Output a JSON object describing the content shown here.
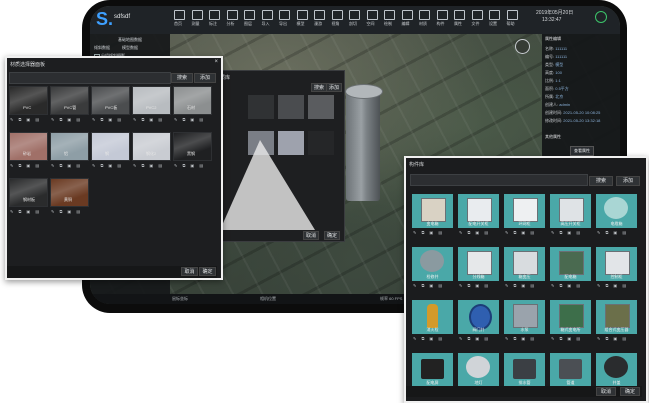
{
  "app": {
    "logo_text": "S.",
    "title": "sdfsdf",
    "datetime_line1": "2019年05月20日",
    "datetime_line2": "13:32:47",
    "toolbar": [
      {
        "label": "首页",
        "icon": "home-icon"
      },
      {
        "label": "测量",
        "icon": "measure-icon"
      },
      {
        "label": "标注",
        "icon": "mark-icon"
      },
      {
        "label": "分析",
        "icon": "analysis-icon"
      },
      {
        "label": "图层",
        "icon": "layer-icon"
      },
      {
        "label": "导入",
        "icon": "import-icon"
      },
      {
        "label": "导出",
        "icon": "export-icon"
      },
      {
        "label": "模型",
        "icon": "model-icon"
      },
      {
        "label": "漫游",
        "icon": "walk-icon"
      },
      {
        "label": "视角",
        "icon": "view-icon"
      },
      {
        "label": "剖切",
        "icon": "section-icon"
      },
      {
        "label": "空间",
        "icon": "space-icon"
      },
      {
        "label": "绘制",
        "icon": "draw-icon"
      },
      {
        "label": "编辑",
        "icon": "edit-icon"
      },
      {
        "label": "材质",
        "icon": "material-icon"
      },
      {
        "label": "构件",
        "icon": "component-icon"
      },
      {
        "label": "属性",
        "icon": "property-icon"
      },
      {
        "label": "文件",
        "icon": "file-icon"
      },
      {
        "label": "设置",
        "icon": "settings-icon"
      },
      {
        "label": "帮助",
        "icon": "help-icon"
      }
    ],
    "left_panel": {
      "tab1": "基础地图数据",
      "tab2": "倾斜数据",
      "tab3": "模型数据",
      "item": "分组倾斜摄影"
    },
    "right_panel": {
      "title": "属性编辑",
      "rows": [
        {
          "label": "名称:",
          "value": "111111"
        },
        {
          "label": "编号:",
          "value": "111111"
        },
        {
          "label": "类型:",
          "value": "模型"
        },
        {
          "label": "高度:",
          "value": "100"
        },
        {
          "label": "比例:",
          "value": "1:1"
        },
        {
          "label": "面积:",
          "value": "0.5平方"
        },
        {
          "label": "所属:",
          "value": "北京"
        },
        {
          "label": "创建人:",
          "value": "admin"
        },
        {
          "label": "创建时间:",
          "value": "2021-05-20 10:08:25"
        },
        {
          "label": "修改时间:",
          "value": "2021-05-20 13:32:18"
        }
      ],
      "section2": "其他属性",
      "button": "查看属性"
    },
    "bottom": {
      "left": "鼠标坐标",
      "mid": "相机位置",
      "right": "帧率 60 FPS"
    }
  },
  "mid_dialog": {
    "title": "材质库",
    "search": "搜索",
    "add": "添加",
    "cancel": "取消",
    "confirm": "确定"
  },
  "material_dialog": {
    "title": "材质选择器面板",
    "search_button": "搜索",
    "add_button": "添加",
    "cancel_button": "取消",
    "confirm_button": "确定",
    "items": [
      {
        "label": "PVC",
        "color": "#2a2a2a"
      },
      {
        "label": "PVC管",
        "color": "#3a3b3c"
      },
      {
        "label": "PVC板",
        "color": "#4b4d4f"
      },
      {
        "label": "PVC2",
        "color": "#b8bcc0"
      },
      {
        "label": "石材",
        "color": "#8c8f90"
      },
      {
        "label": "砂岩",
        "color": "#a07068"
      },
      {
        "label": "铝",
        "color": "#8e9ea6"
      },
      {
        "label": "钢",
        "color": "#c4c9d6"
      },
      {
        "label": "钢化2",
        "color": "#c9ccd2"
      },
      {
        "label": "黑钢",
        "color": "#1f2022"
      },
      {
        "label": "钢材板",
        "color": "#2a2b2c"
      },
      {
        "label": "黄铜",
        "color": "#6a3a22"
      }
    ]
  },
  "equipment_dialog": {
    "title": "构件库",
    "search_button": "搜索",
    "add_button": "添加",
    "cancel_button": "取消",
    "confirm_button": "确定",
    "items": [
      {
        "label": "变电箱",
        "shape": "cabinet",
        "color": "#d9d2c4"
      },
      {
        "label": "配电开关柜",
        "shape": "cabinet",
        "color": "#e9ecef"
      },
      {
        "label": "环网柜",
        "shape": "cabinet",
        "color": "#eef0f2"
      },
      {
        "label": "高压开关柜",
        "shape": "cabinet",
        "color": "#dfe3e6"
      },
      {
        "label": "电缆箱",
        "shape": "tank",
        "color": "#a9d6d4"
      },
      {
        "label": "检修井",
        "shape": "disc",
        "color": "#8a9aa0"
      },
      {
        "label": "分线箱",
        "shape": "cabinet",
        "color": "#e6e8ea"
      },
      {
        "label": "箱变压",
        "shape": "cabinet",
        "color": "#d8dcdf"
      },
      {
        "label": "配电箱",
        "shape": "transformer",
        "color": "#4a6a50"
      },
      {
        "label": "控制柜",
        "shape": "cabinet",
        "color": "#e2e5e8"
      },
      {
        "label": "消火栓",
        "shape": "hydrant",
        "color": "#d49a2a"
      },
      {
        "label": "阀门井",
        "shape": "valve",
        "color": "#2f5fb0"
      },
      {
        "label": "水泵",
        "shape": "pump",
        "color": "#9aa3ac"
      },
      {
        "label": "箱式变电所",
        "shape": "transformer",
        "color": "#3d6e4a"
      },
      {
        "label": "组合式变压器",
        "shape": "box",
        "color": "#6b6f4a"
      },
      {
        "label": "配电屏",
        "shape": "screen",
        "color": "#222"
      },
      {
        "label": "地灯",
        "shape": "disc",
        "color": "#d0d4d8"
      },
      {
        "label": "排水管",
        "shape": "pipe",
        "color": "#3b3f44"
      },
      {
        "label": "管道",
        "shape": "pipe",
        "color": "#4b4f54"
      },
      {
        "label": "井盖",
        "shape": "disc",
        "color": "#2a2c2e"
      }
    ]
  }
}
